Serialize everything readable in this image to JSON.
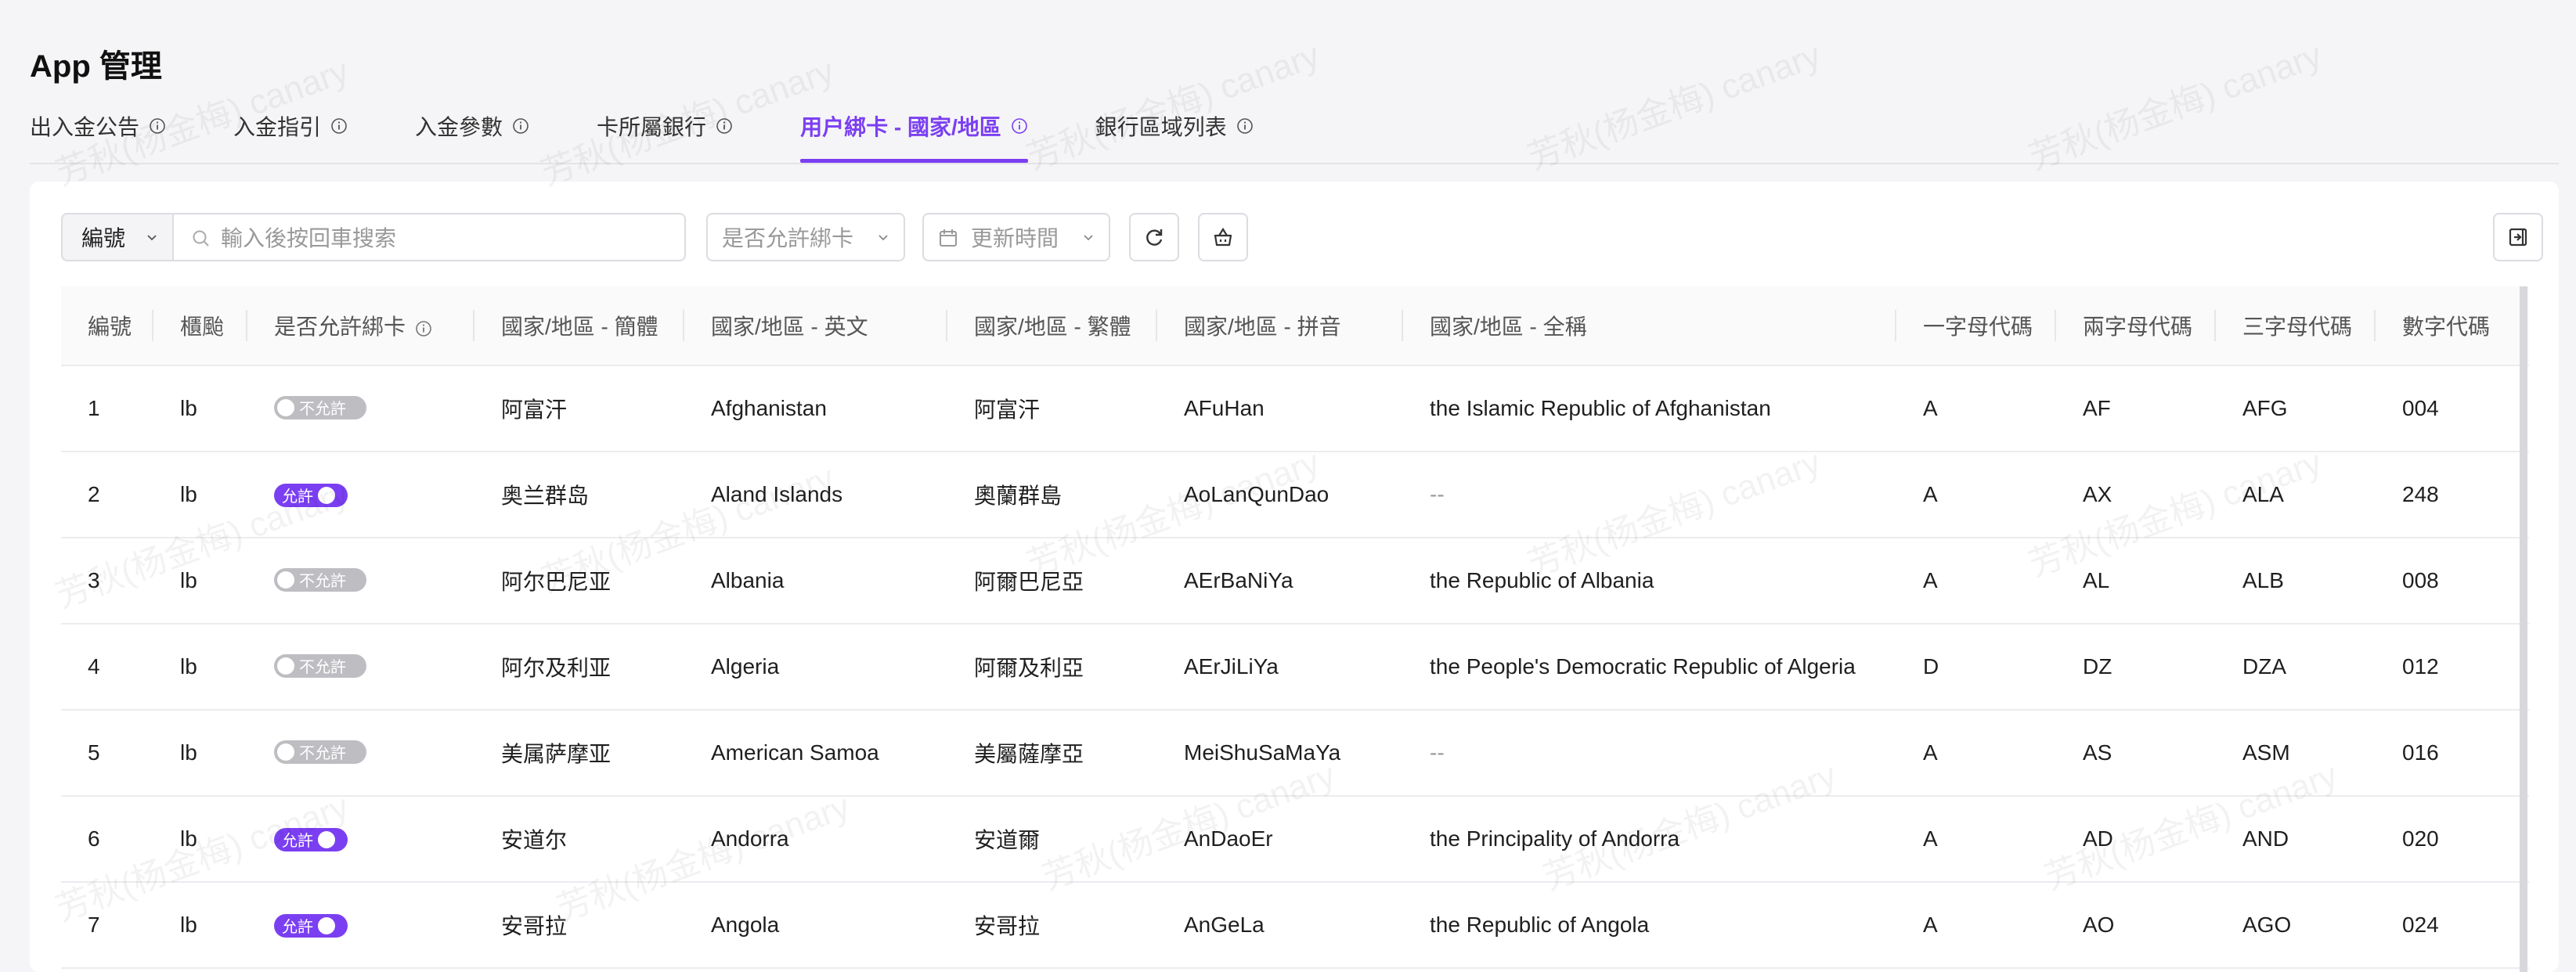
{
  "page_title": "App 管理",
  "tabs": [
    {
      "label": "出入金公告",
      "active": false
    },
    {
      "label": "入金指引",
      "active": false
    },
    {
      "label": "入金參數",
      "active": false
    },
    {
      "label": "卡所屬銀行",
      "active": false
    },
    {
      "label": "用户綁卡 - 國家/地區",
      "active": true
    },
    {
      "label": "銀行區域列表",
      "active": false
    }
  ],
  "toolbar": {
    "field_select": "編號",
    "search_placeholder": "輸入後按回車搜索",
    "allow_filter_placeholder": "是否允許綁卡",
    "date_filter_placeholder": "更新時間"
  },
  "table": {
    "columns": [
      "編號",
      "櫃颱",
      "是否允許綁卡",
      "國家/地區 - 簡體",
      "國家/地區 - 英文",
      "國家/地區 - 繁體",
      "國家/地區 - 拼音",
      "國家/地區 - 全稱",
      "一字母代碼",
      "兩字母代碼",
      "三字母代碼",
      "數字代碼"
    ],
    "toggle_labels": {
      "on": "允許",
      "off": "不允許"
    },
    "rows": [
      {
        "id": "1",
        "counter": "lb",
        "allowed": false,
        "simplified": "阿富汗",
        "english": "Afghanistan",
        "traditional": "阿富汗",
        "pinyin": "AFuHan",
        "full_name": "the Islamic Republic of Afghanistan",
        "code1": "A",
        "code2": "AF",
        "code3": "AFG",
        "numeric": "004"
      },
      {
        "id": "2",
        "counter": "lb",
        "allowed": true,
        "simplified": "奥兰群岛",
        "english": "Aland Islands",
        "traditional": "奧蘭群島",
        "pinyin": "AoLanQunDao",
        "full_name": "--",
        "code1": "A",
        "code2": "AX",
        "code3": "ALA",
        "numeric": "248"
      },
      {
        "id": "3",
        "counter": "lb",
        "allowed": false,
        "simplified": "阿尔巴尼亚",
        "english": "Albania",
        "traditional": "阿爾巴尼亞",
        "pinyin": "AErBaNiYa",
        "full_name": "the Republic of Albania",
        "code1": "A",
        "code2": "AL",
        "code3": "ALB",
        "numeric": "008"
      },
      {
        "id": "4",
        "counter": "lb",
        "allowed": false,
        "simplified": "阿尔及利亚",
        "english": "Algeria",
        "traditional": "阿爾及利亞",
        "pinyin": "AErJiLiYa",
        "full_name": "the People's Democratic Republic of Algeria",
        "code1": "D",
        "code2": "DZ",
        "code3": "DZA",
        "numeric": "012"
      },
      {
        "id": "5",
        "counter": "lb",
        "allowed": false,
        "simplified": "美属萨摩亚",
        "english": "American Samoa",
        "traditional": "美屬薩摩亞",
        "pinyin": "MeiShuSaMaYa",
        "full_name": "--",
        "code1": "A",
        "code2": "AS",
        "code3": "ASM",
        "numeric": "016"
      },
      {
        "id": "6",
        "counter": "lb",
        "allowed": true,
        "simplified": "安道尔",
        "english": "Andorra",
        "traditional": "安道爾",
        "pinyin": "AnDaoEr",
        "full_name": "the Principality of Andorra",
        "code1": "A",
        "code2": "AD",
        "code3": "AND",
        "numeric": "020"
      },
      {
        "id": "7",
        "counter": "lb",
        "allowed": true,
        "simplified": "安哥拉",
        "english": "Angola",
        "traditional": "安哥拉",
        "pinyin": "AnGeLa",
        "full_name": "the Republic of Angola",
        "code1": "A",
        "code2": "AO",
        "code3": "AGO",
        "numeric": "024"
      }
    ]
  },
  "watermark": "芳秋(杨金梅) canary",
  "colors": {
    "accent": "#7b3ff2",
    "toggle_off": "#bdbdc2"
  }
}
